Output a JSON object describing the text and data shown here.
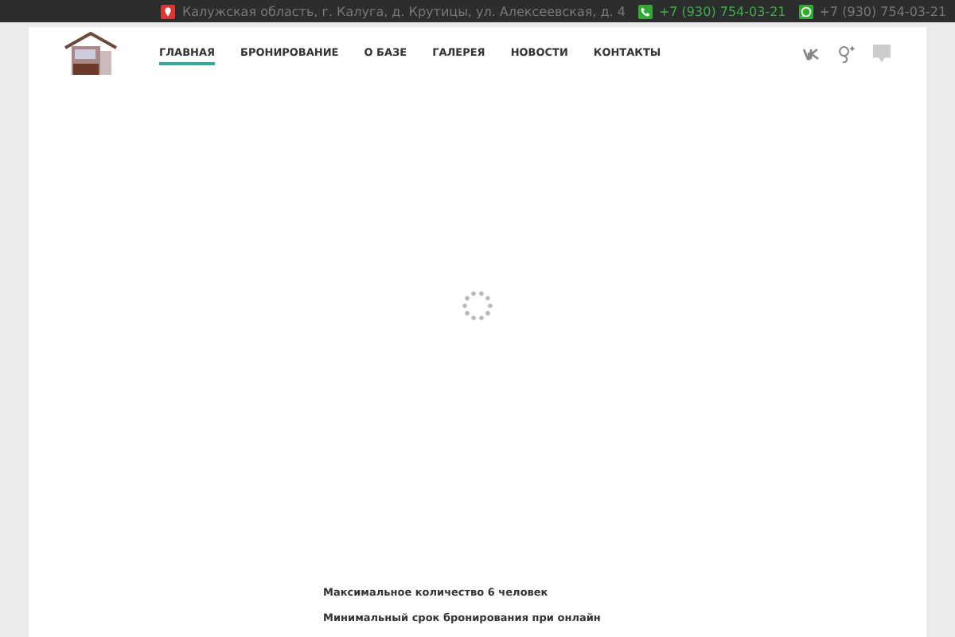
{
  "top_bar": {
    "address": "Калужская область, г. Калуга, д. Крутицы, ул. Алексеевская, д. 4",
    "phones": [
      {
        "kind": "phone",
        "number": "+7 (930) 754-03-21"
      },
      {
        "kind": "whatsapp",
        "number": "+7 (930) 754-03-21"
      }
    ]
  },
  "nav": [
    {
      "label": "ГЛАВНАЯ",
      "selected": true
    },
    {
      "label": "БРОНИРОВАНИЕ",
      "selected": false
    },
    {
      "label": "О БАЗЕ",
      "selected": false
    },
    {
      "label": "ГАЛЕРЕЯ",
      "selected": false
    },
    {
      "label": "НОВОСТИ",
      "selected": false
    },
    {
      "label": "КОНТАКТЫ",
      "selected": false
    }
  ],
  "social": [
    {
      "kind": "vk"
    },
    {
      "kind": "gplus"
    },
    {
      "kind": "chat"
    }
  ],
  "content": [
    "Максимальное количество 6 человек",
    "Минимальный срок бронирования при онлайн"
  ]
}
